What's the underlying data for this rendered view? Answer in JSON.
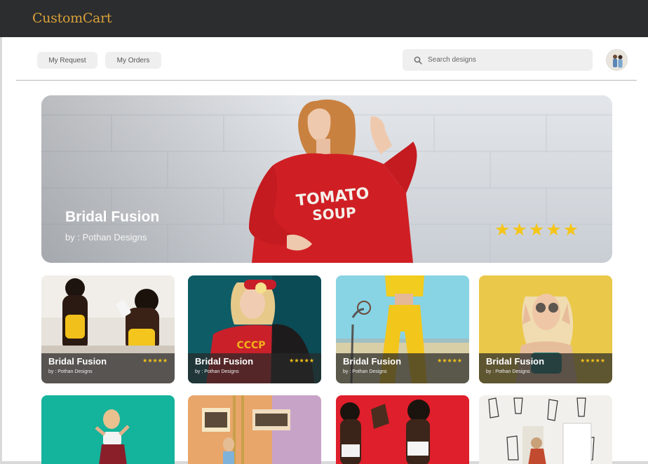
{
  "app": {
    "brand": "CustomCart"
  },
  "nav": {
    "my_request": "My Request",
    "my_orders": "My Orders"
  },
  "search": {
    "placeholder": "Search designs",
    "icon": "search-icon"
  },
  "hero": {
    "title": "Bridal Fusion",
    "subtitle": "by : Pothan Designs",
    "rating": 5,
    "stars": "★★★★★",
    "shirt_text_1": "TOMATO",
    "shirt_text_2": "SOUP"
  },
  "cards": [
    {
      "title": "Bridal Fusion",
      "subtitle": "by : Pothan Designs",
      "rating": 5,
      "stars": "★★★★★"
    },
    {
      "title": "Bridal Fusion",
      "subtitle": "by : Pothan Designs",
      "rating": 5,
      "stars": "★★★★★"
    },
    {
      "title": "Bridal Fusion",
      "subtitle": "by : Pothan Designs",
      "rating": 5,
      "stars": "★★★★★"
    },
    {
      "title": "Bridal Fusion",
      "subtitle": "by : Pothan Designs",
      "rating": 5,
      "stars": "★★★★★"
    }
  ],
  "colors": {
    "topbar": "#2c2d2f",
    "brand": "#d9a23a",
    "star": "#f5c518"
  }
}
